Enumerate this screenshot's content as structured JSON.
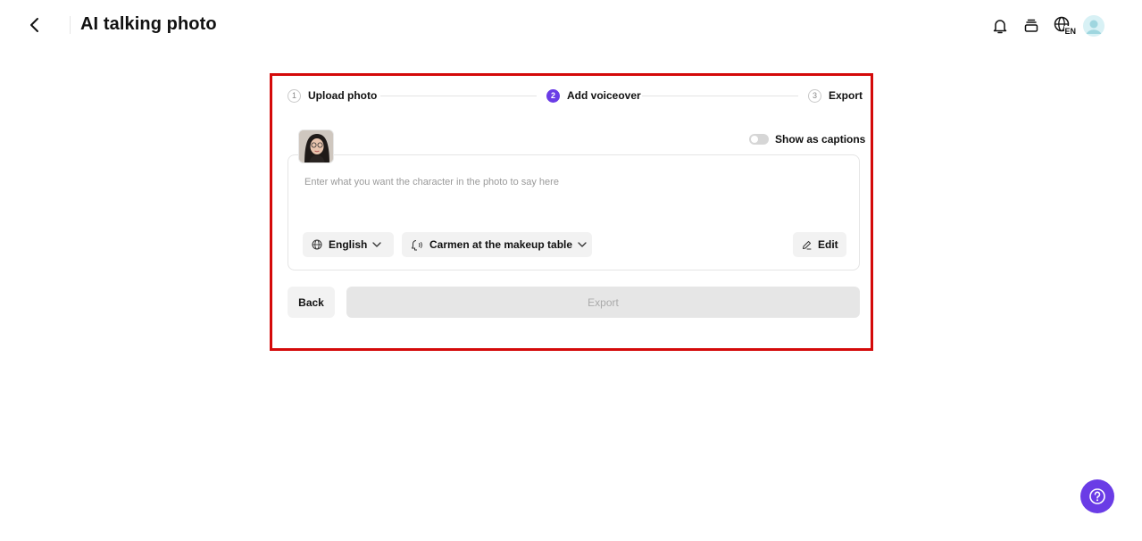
{
  "header": {
    "title": "AI talking photo",
    "lang_badge": "EN",
    "icons": [
      "back-arrow-icon",
      "bell-icon",
      "layers-icon",
      "globe-icon",
      "avatar"
    ]
  },
  "stepper": {
    "steps": [
      {
        "num": "1",
        "label": "Upload photo",
        "state": "done"
      },
      {
        "num": "2",
        "label": "Add voiceover",
        "state": "active"
      },
      {
        "num": "3",
        "label": "Export",
        "state": "pending"
      }
    ]
  },
  "captions": {
    "label": "Show as captions",
    "enabled": false
  },
  "script_input": {
    "value": "",
    "placeholder": "Enter what you want the character in the photo to say here"
  },
  "controls": {
    "language": "English",
    "voice": "Carmen at the makeup table",
    "edit": "Edit"
  },
  "actions": {
    "back": "Back",
    "export": "Export"
  },
  "colors": {
    "accent": "#6a3ce6",
    "highlight_border": "#d40a0a",
    "muted_bg": "#f2f2f2"
  }
}
